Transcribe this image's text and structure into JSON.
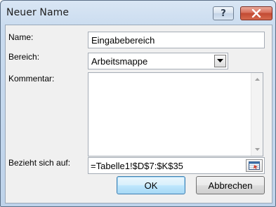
{
  "dialog": {
    "title": "Neuer Name",
    "help_glyph": "?",
    "close_icon": "close-x-icon"
  },
  "fields": {
    "name_label": "Name:",
    "name_value": "Eingabebereich",
    "scope_label": "Bereich:",
    "scope_value": "Arbeitsmappe",
    "comment_label": "Kommentar:",
    "comment_value": "",
    "refers_label": "Bezieht sich auf:",
    "refers_value": "=Tabelle1!$D$7:$K$35"
  },
  "buttons": {
    "ok": "OK",
    "cancel": "Abbrechen"
  },
  "colors": {
    "close_button": "#c24a33",
    "default_button_border": "#3c7fb1"
  }
}
